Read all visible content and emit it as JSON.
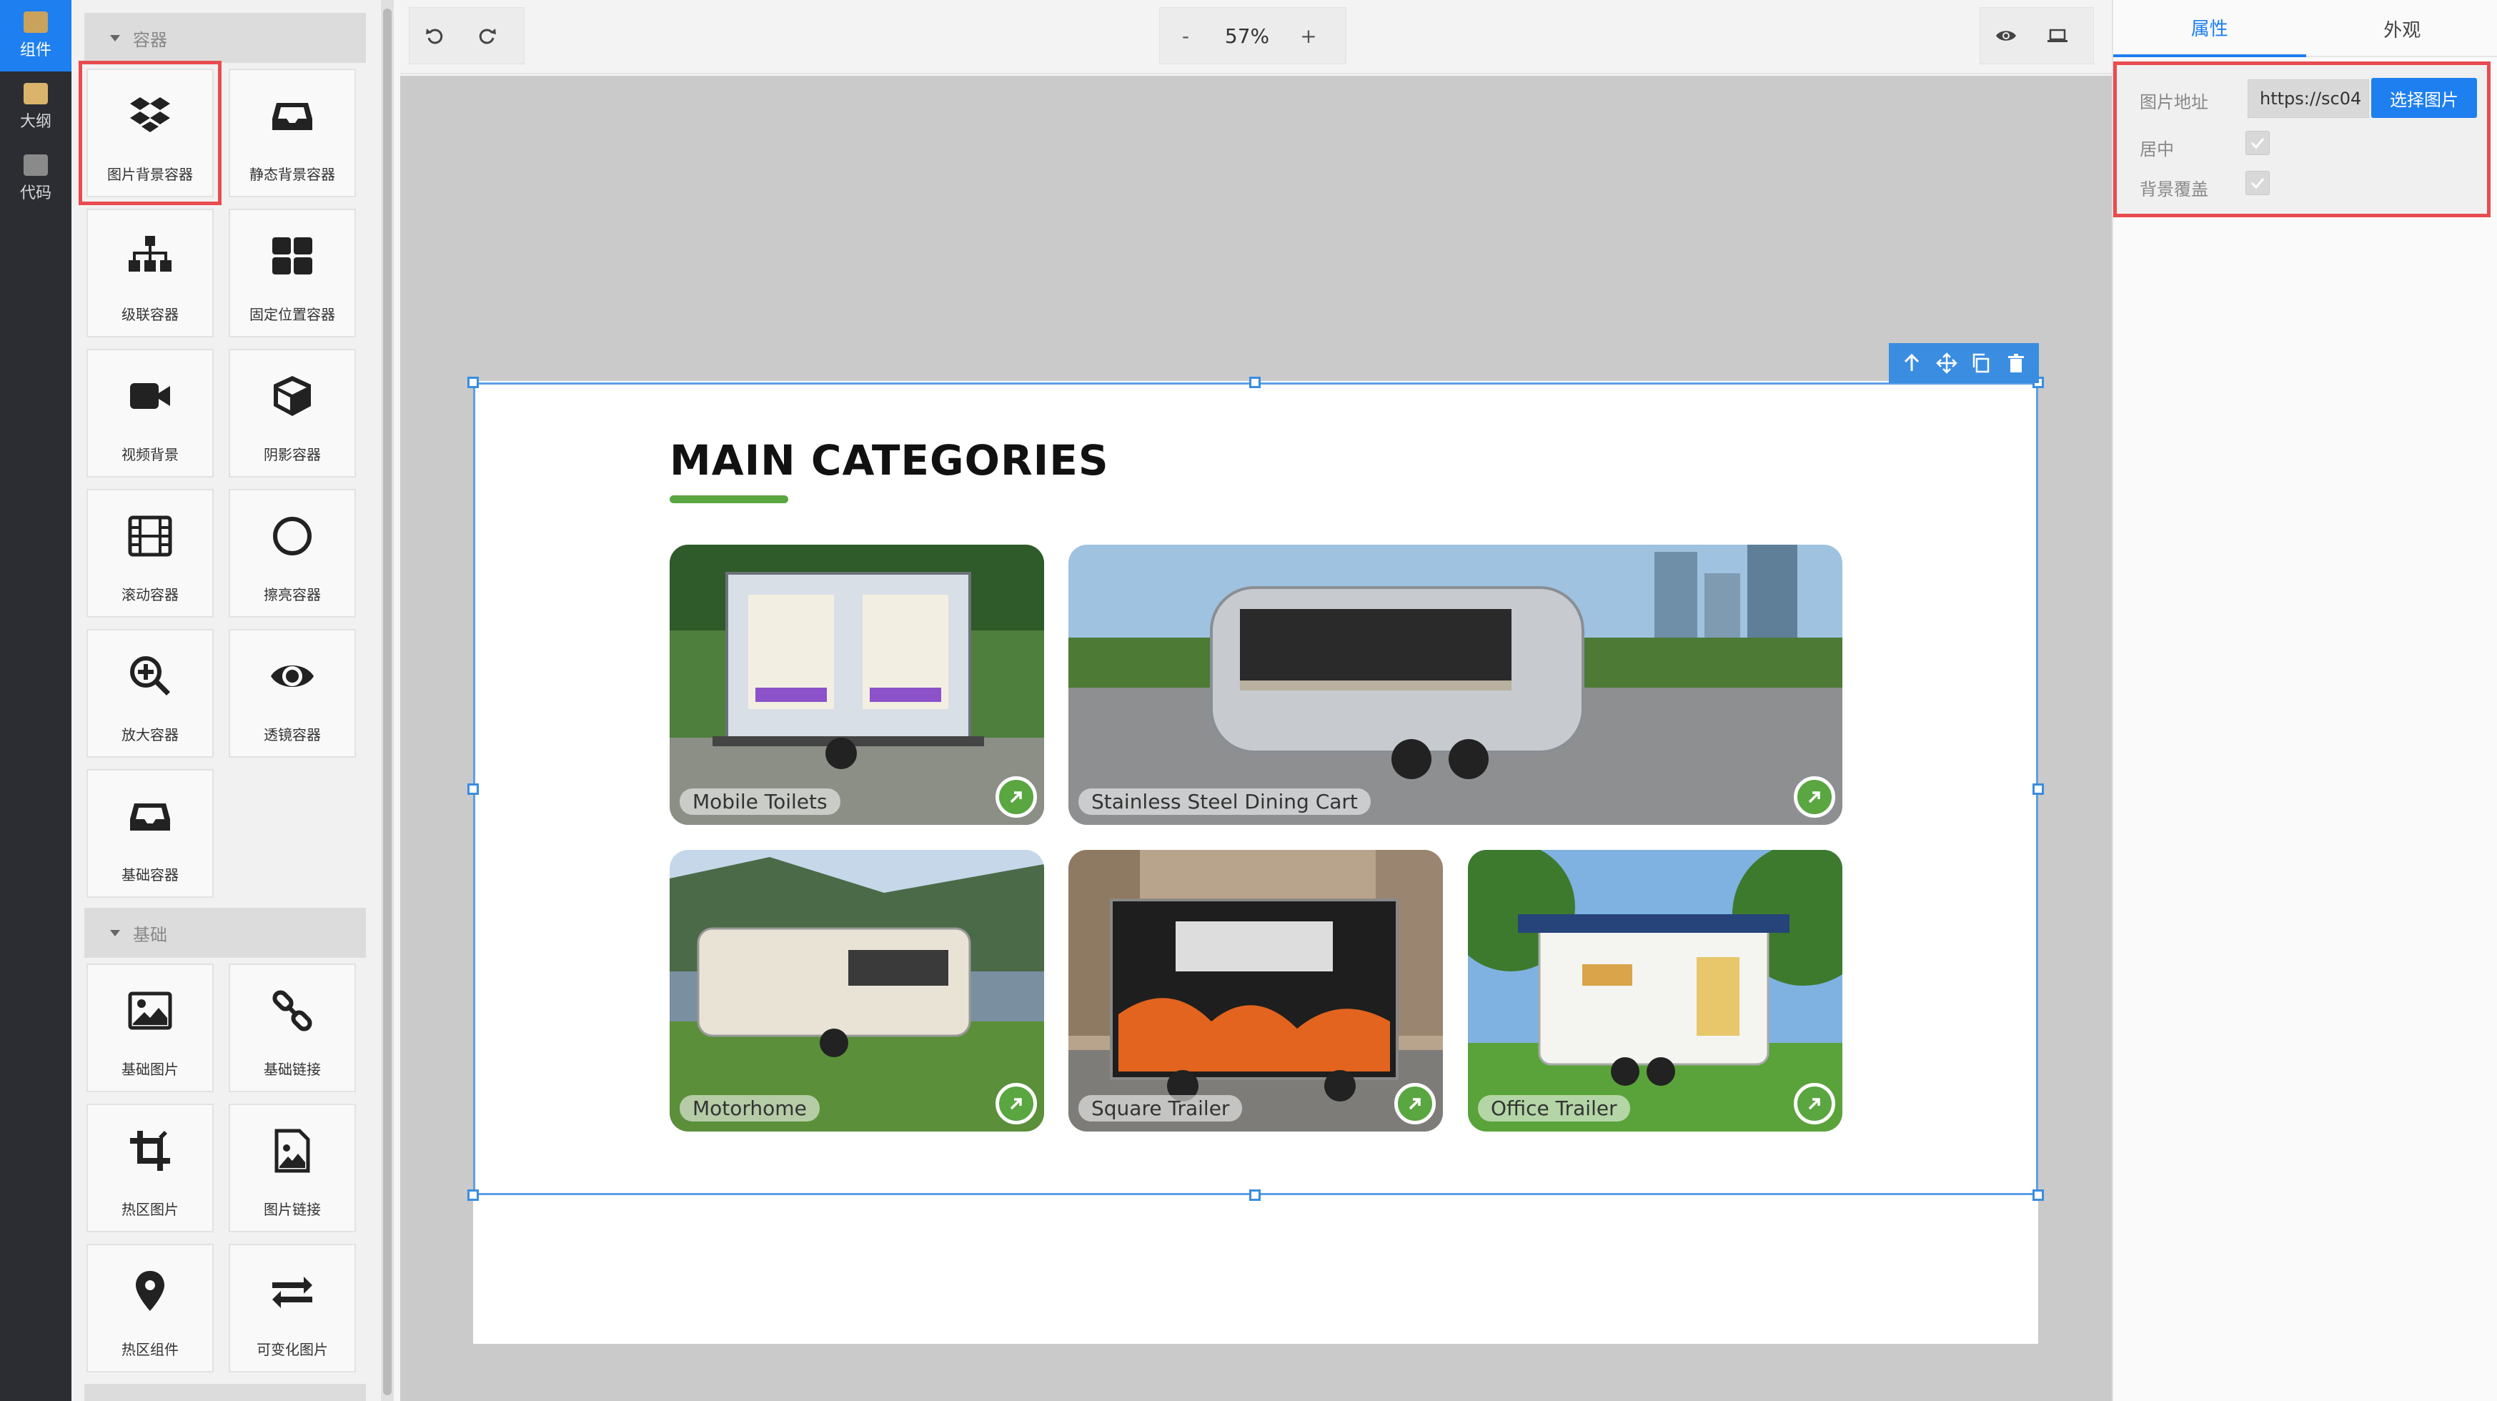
{
  "sidebar": {
    "items": [
      {
        "label": "组件"
      },
      {
        "label": "大纲"
      },
      {
        "label": "代码"
      }
    ]
  },
  "panel": {
    "sections": [
      {
        "title": "容器"
      },
      {
        "title": "基础"
      }
    ],
    "container_tiles": [
      {
        "label": "图片背景容器",
        "icon": "dropbox-icon"
      },
      {
        "label": "静态背景容器",
        "icon": "inbox-icon"
      },
      {
        "label": "级联容器",
        "icon": "sitemap-icon"
      },
      {
        "label": "固定位置容器",
        "icon": "grid-icon"
      },
      {
        "label": "视频背景",
        "icon": "video-camera-icon"
      },
      {
        "label": "阴影容器",
        "icon": "cube-icon"
      },
      {
        "label": "滚动容器",
        "icon": "film-icon"
      },
      {
        "label": "擦亮容器",
        "icon": "circle-icon"
      },
      {
        "label": "放大容器",
        "icon": "zoom-in-icon"
      },
      {
        "label": "透镜容器",
        "icon": "eye-icon"
      },
      {
        "label": "基础容器",
        "icon": "inbox-icon"
      }
    ],
    "basic_tiles": [
      {
        "label": "基础图片",
        "icon": "image-icon"
      },
      {
        "label": "基础链接",
        "icon": "link-icon"
      },
      {
        "label": "热区图片",
        "icon": "crop-icon"
      },
      {
        "label": "图片链接",
        "icon": "image-link-icon"
      },
      {
        "label": "热区组件",
        "icon": "map-marker-icon"
      },
      {
        "label": "可变化图片",
        "icon": "exchange-icon"
      }
    ]
  },
  "toolbar": {
    "zoom_minus": "-",
    "zoom_value": "57%",
    "zoom_plus": "+"
  },
  "canvas": {
    "title": "MAIN CATEGORIES",
    "cards": [
      {
        "label": "Mobile Toilets"
      },
      {
        "label": "Stainless Steel Dining Cart"
      },
      {
        "label": "Motorhome"
      },
      {
        "label": "Square Trailer"
      },
      {
        "label": "Office Trailer"
      }
    ]
  },
  "props": {
    "tabs": [
      {
        "label": "属性"
      },
      {
        "label": "外观"
      }
    ],
    "image_url_label": "图片地址",
    "image_url_value": "https://sc04",
    "pick_button": "选择图片",
    "center_label": "居中",
    "cover_label": "背景覆盖"
  },
  "colors": {
    "accent": "#1e7ff0",
    "highlight_red": "#e84c4f",
    "brand_green": "#5aa641"
  }
}
